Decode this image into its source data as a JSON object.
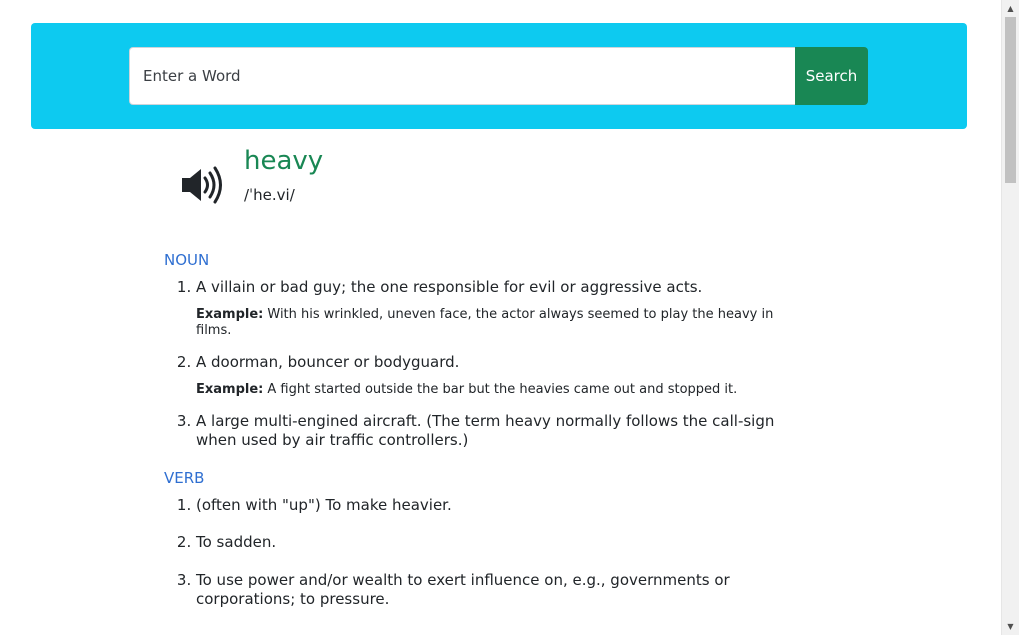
{
  "search": {
    "placeholder": "Enter a Word",
    "value": "",
    "button_label": "Search"
  },
  "entry": {
    "word": "heavy",
    "phonetic": "/ˈhe.vi/",
    "audio_icon": "speaker-icon"
  },
  "meanings": [
    {
      "part_of_speech": "NOUN",
      "definitions": [
        {
          "text": "A villain or bad guy; the one responsible for evil or aggressive acts.",
          "example_label": "Example:",
          "example": "With his wrinkled, uneven face, the actor always seemed to play the heavy in films."
        },
        {
          "text": "A doorman, bouncer or bodyguard.",
          "example_label": "Example:",
          "example": "A fight started outside the bar but the heavies came out and stopped it."
        },
        {
          "text": "A large multi-engined aircraft. (The term heavy normally follows the call-sign when used by air traffic controllers.)"
        }
      ]
    },
    {
      "part_of_speech": "VERB",
      "definitions": [
        {
          "text": "(often with \"up\") To make heavier."
        },
        {
          "text": "To sadden."
        },
        {
          "text": "To use power and/or wealth to exert influence on, e.g., governments or corporations; to pressure."
        }
      ]
    }
  ],
  "colors": {
    "banner": "#0dcaf0",
    "search_button": "#198754",
    "headword": "#198754",
    "part_of_speech": "#2f6fd1"
  }
}
